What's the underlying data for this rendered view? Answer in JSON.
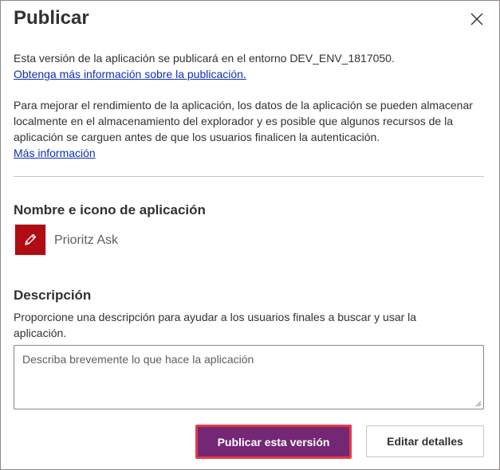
{
  "dialog": {
    "title": "Publicar",
    "intro_text": "Esta versión de la aplicación se publicará en el entorno DEV_ENV_1817050.",
    "intro_link": "Obtenga más información sobre la publicación.",
    "perf_text": "Para mejorar el rendimiento de la aplicación, los datos de la aplicación se pueden almacenar localmente en el almacenamiento del explorador y es posible que algunos recursos de la aplicación se carguen antes de que los usuarios finalicen la autenticación.",
    "perf_link": "Más información"
  },
  "app_section": {
    "title": "Nombre e icono de aplicación",
    "app_name": "Prioritz Ask",
    "icon": "pencil-icon",
    "icon_bg_color": "#b00c14"
  },
  "description_section": {
    "title": "Descripción",
    "help_text": "Proporcione una descripción para ayudar a los usuarios finales a buscar y usar la aplicación.",
    "placeholder": "Describa brevemente lo que hace la aplicación",
    "value": ""
  },
  "buttons": {
    "publish_label": "Publicar esta versión",
    "edit_label": "Editar detalles"
  },
  "colors": {
    "primary": "#742774",
    "highlight_border": "#e33a46",
    "link": "#0f2fb5"
  }
}
